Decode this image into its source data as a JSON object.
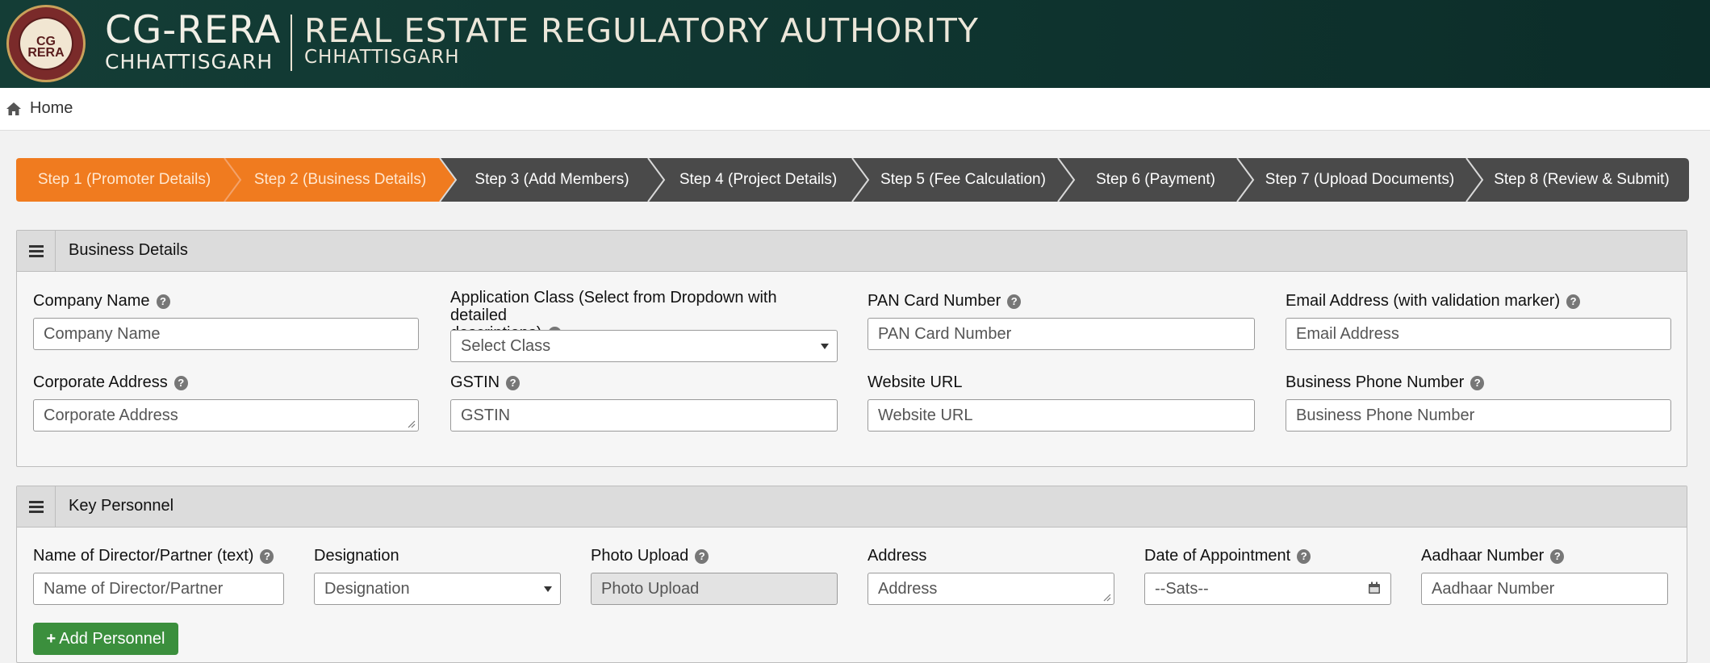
{
  "header": {
    "logo_text": "CG RERA",
    "brand_name": "CG-RERA",
    "brand_state": "CHHATTISGARH",
    "title": "REAL ESTATE REGULATORY AUTHORITY",
    "subtitle": "CHHATTISGARH",
    "bg_color": "#0f3530"
  },
  "breadcrumb": {
    "home": "Home"
  },
  "steps": [
    {
      "label": "Step 1 (Promoter Details)",
      "state": "done"
    },
    {
      "label": "Step 2 (Business Details)",
      "state": "active"
    },
    {
      "label": "Step 3 (Add Members)",
      "state": "todo"
    },
    {
      "label": "Step 4 (Project Details)",
      "state": "todo"
    },
    {
      "label": "Step 5 (Fee Calculation)",
      "state": "todo"
    },
    {
      "label": "Step 6 (Payment)",
      "state": "todo"
    },
    {
      "label": "Step 7 (Upload Documents)",
      "state": "todo"
    },
    {
      "label": "Step 8 (Review & Submit)",
      "state": "todo"
    }
  ],
  "colors": {
    "active_step": "#f07b1f",
    "inactive_step": "#4a4a4a",
    "add_button": "#3b8f3d"
  },
  "business": {
    "title": "Business Details",
    "company_name": {
      "label": "Company Name",
      "placeholder": "Company Name"
    },
    "application_class": {
      "label_line1": "Application Class (Select from Dropdown with detailed",
      "label_line2": "descriptions)",
      "value": "Select Class"
    },
    "pan": {
      "label": "PAN Card Number",
      "placeholder": "PAN Card Number"
    },
    "email": {
      "label": "Email Address (with validation marker)",
      "placeholder": "Email Address"
    },
    "corporate_address": {
      "label": "Corporate Address",
      "placeholder": "Corporate Address"
    },
    "gstin": {
      "label": "GSTIN",
      "placeholder": "GSTIN"
    },
    "website": {
      "label": "Website URL",
      "placeholder": "Website URL"
    },
    "phone": {
      "label": "Business Phone Number",
      "placeholder": "Business Phone Number"
    }
  },
  "personnel": {
    "title": "Key Personnel",
    "director": {
      "label": "Name of Director/Partner (text)",
      "placeholder": "Name of Director/Partner"
    },
    "designation": {
      "label": "Designation",
      "value": "Designation"
    },
    "photo": {
      "label": "Photo Upload",
      "placeholder": "Photo Upload"
    },
    "address": {
      "label": "Address",
      "placeholder": "Address"
    },
    "appointment": {
      "label": "Date of Appointment",
      "value": "--Sats--"
    },
    "aadhaar": {
      "label": "Aadhaar Number",
      "placeholder": "Aadhaar Number"
    },
    "add_button": "Add Personnel"
  }
}
